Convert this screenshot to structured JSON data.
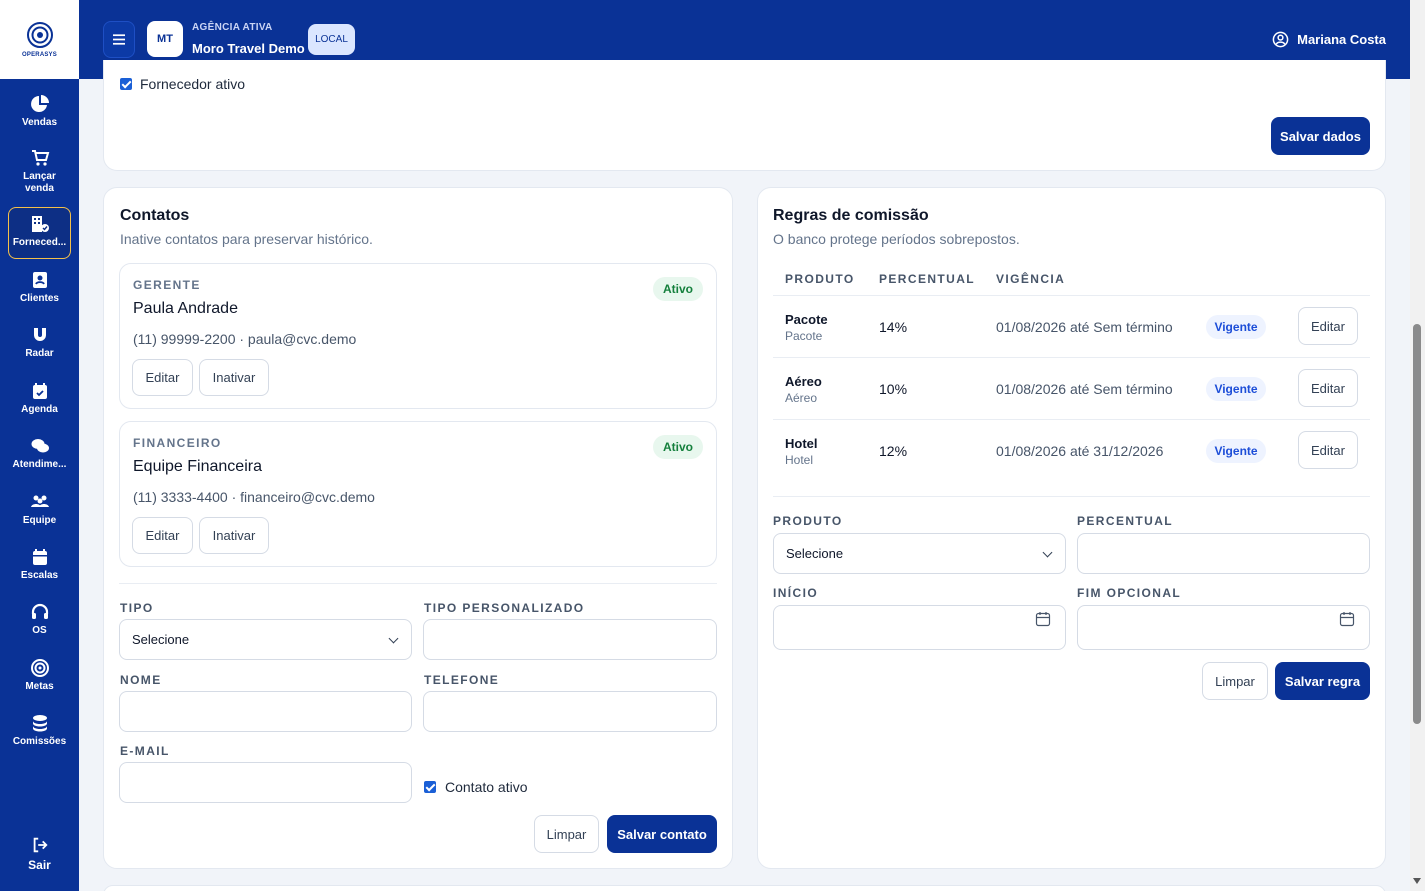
{
  "brand": {
    "logo_text": "OPERASYS",
    "primary_color": "#0a3296",
    "accent_color": "#f4c04a"
  },
  "sidebar": {
    "items": [
      {
        "label": "Vendas",
        "icon": "pie-chart-icon"
      },
      {
        "label": "Lançar venda",
        "icon": "cart-icon"
      },
      {
        "label": "Forneced...",
        "icon": "building-check-icon",
        "active": true
      },
      {
        "label": "Clientes",
        "icon": "contact-card-icon"
      },
      {
        "label": "Radar",
        "icon": "magnet-icon"
      },
      {
        "label": "Agenda",
        "icon": "calendar-check-icon"
      },
      {
        "label": "Atendime...",
        "icon": "chat-bubbles-icon"
      },
      {
        "label": "Equipe",
        "icon": "users-icon"
      },
      {
        "label": "Escalas",
        "icon": "calendar-icon"
      },
      {
        "label": "OS",
        "icon": "headset-icon"
      },
      {
        "label": "Metas",
        "icon": "target-icon"
      },
      {
        "label": "Comissões",
        "icon": "coins-icon"
      }
    ],
    "logout_label": "Sair"
  },
  "header": {
    "menu_icon": "hamburger-icon",
    "agency_initials": "MT",
    "agency_label": "AGÊNCIA ATIVA",
    "agency_name": "Moro Travel Demo",
    "env_badge": "LOCAL",
    "user_name": "Mariana Costa"
  },
  "supplier": {
    "active_label": "Fornecedor ativo",
    "active_checked": true,
    "save_label": "Salvar dados"
  },
  "contacts": {
    "title": "Contatos",
    "subtitle": "Inative contatos para preservar histórico.",
    "items": [
      {
        "type": "GERENTE",
        "name": "Paula Andrade",
        "info": "(11) 99999-2200 · paula@cvc.demo",
        "status": "Ativo",
        "edit_label": "Editar",
        "deactivate_label": "Inativar"
      },
      {
        "type": "FINANCEIRO",
        "name": "Equipe Financeira",
        "info": "(11) 3333-4400 · financeiro@cvc.demo",
        "status": "Ativo",
        "edit_label": "Editar",
        "deactivate_label": "Inativar"
      }
    ],
    "form": {
      "type_label": "TIPO",
      "type_value": "Selecione",
      "custom_type_label": "TIPO PERSONALIZADO",
      "name_label": "NOME",
      "phone_label": "TELEFONE",
      "email_label": "E-MAIL",
      "active_label": "Contato ativo",
      "active_checked": true,
      "clear_label": "Limpar",
      "save_label": "Salvar contato"
    }
  },
  "commission": {
    "title": "Regras de comissão",
    "subtitle": "O banco protege períodos sobrepostos.",
    "columns": [
      "PRODUTO",
      "PERCENTUAL",
      "VIGÊNCIA"
    ],
    "rows": [
      {
        "product": "Pacote",
        "product_sub": "Pacote",
        "percent": "14%",
        "period": "01/08/2026 até Sem término",
        "status": "Vigente",
        "edit_label": "Editar"
      },
      {
        "product": "Aéreo",
        "product_sub": "Aéreo",
        "percent": "10%",
        "period": "01/08/2026 até Sem término",
        "status": "Vigente",
        "edit_label": "Editar"
      },
      {
        "product": "Hotel",
        "product_sub": "Hotel",
        "percent": "12%",
        "period": "01/08/2026 até 31/12/2026",
        "status": "Vigente",
        "edit_label": "Editar"
      }
    ],
    "form": {
      "product_label": "PRODUTO",
      "product_value": "Selecione",
      "percent_label": "PERCENTUAL",
      "start_label": "INÍCIO",
      "end_label": "FIM OPCIONAL",
      "clear_label": "Limpar",
      "save_label": "Salvar regra"
    }
  }
}
